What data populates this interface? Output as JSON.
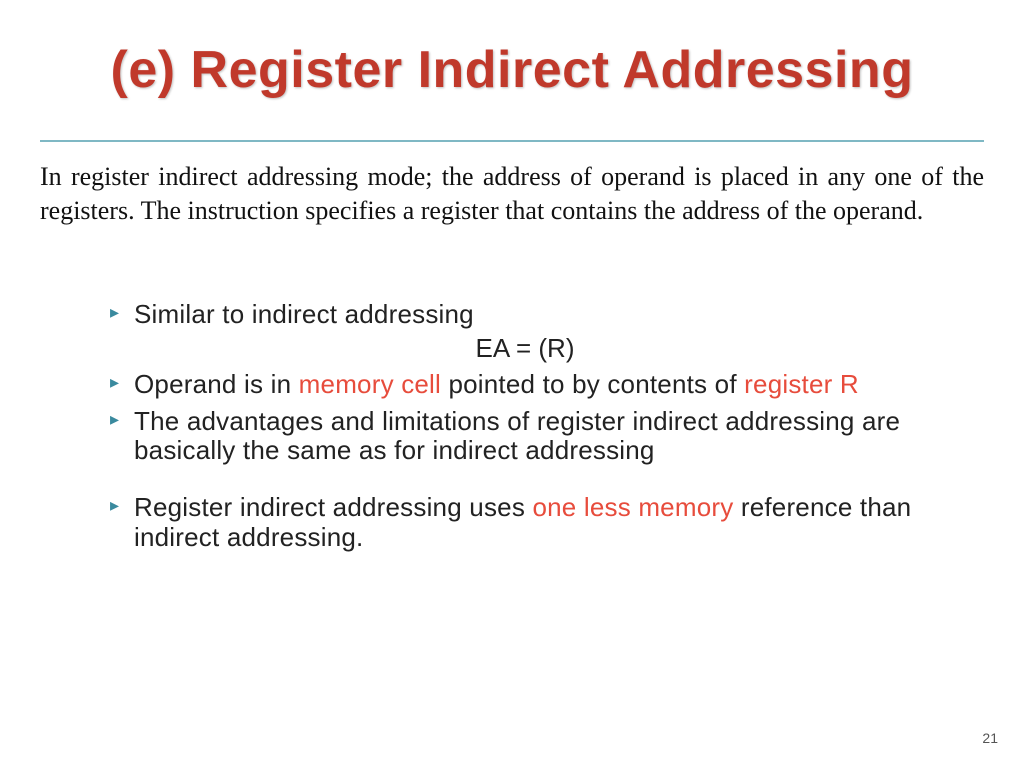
{
  "title": "(e) Register Indirect Addressing",
  "intro": "In register indirect addressing mode; the address of operand is placed in any one of the registers. The instruction specifies a register that contains the address of the operand.",
  "bullets": {
    "b1": "Similar to indirect addressing",
    "formula": "EA = (R)",
    "b2_a": "Operand is in ",
    "b2_h1": "memory cell",
    "b2_b": " pointed to by contents of ",
    "b2_h2": "register R",
    "b3": "The advantages and limitations of register indirect addressing are basically the same as for indirect addressing",
    "b4_a": "Register indirect addressing uses ",
    "b4_h1": "one less memory",
    "b4_b": " reference than indirect addressing."
  },
  "page_number": "21"
}
